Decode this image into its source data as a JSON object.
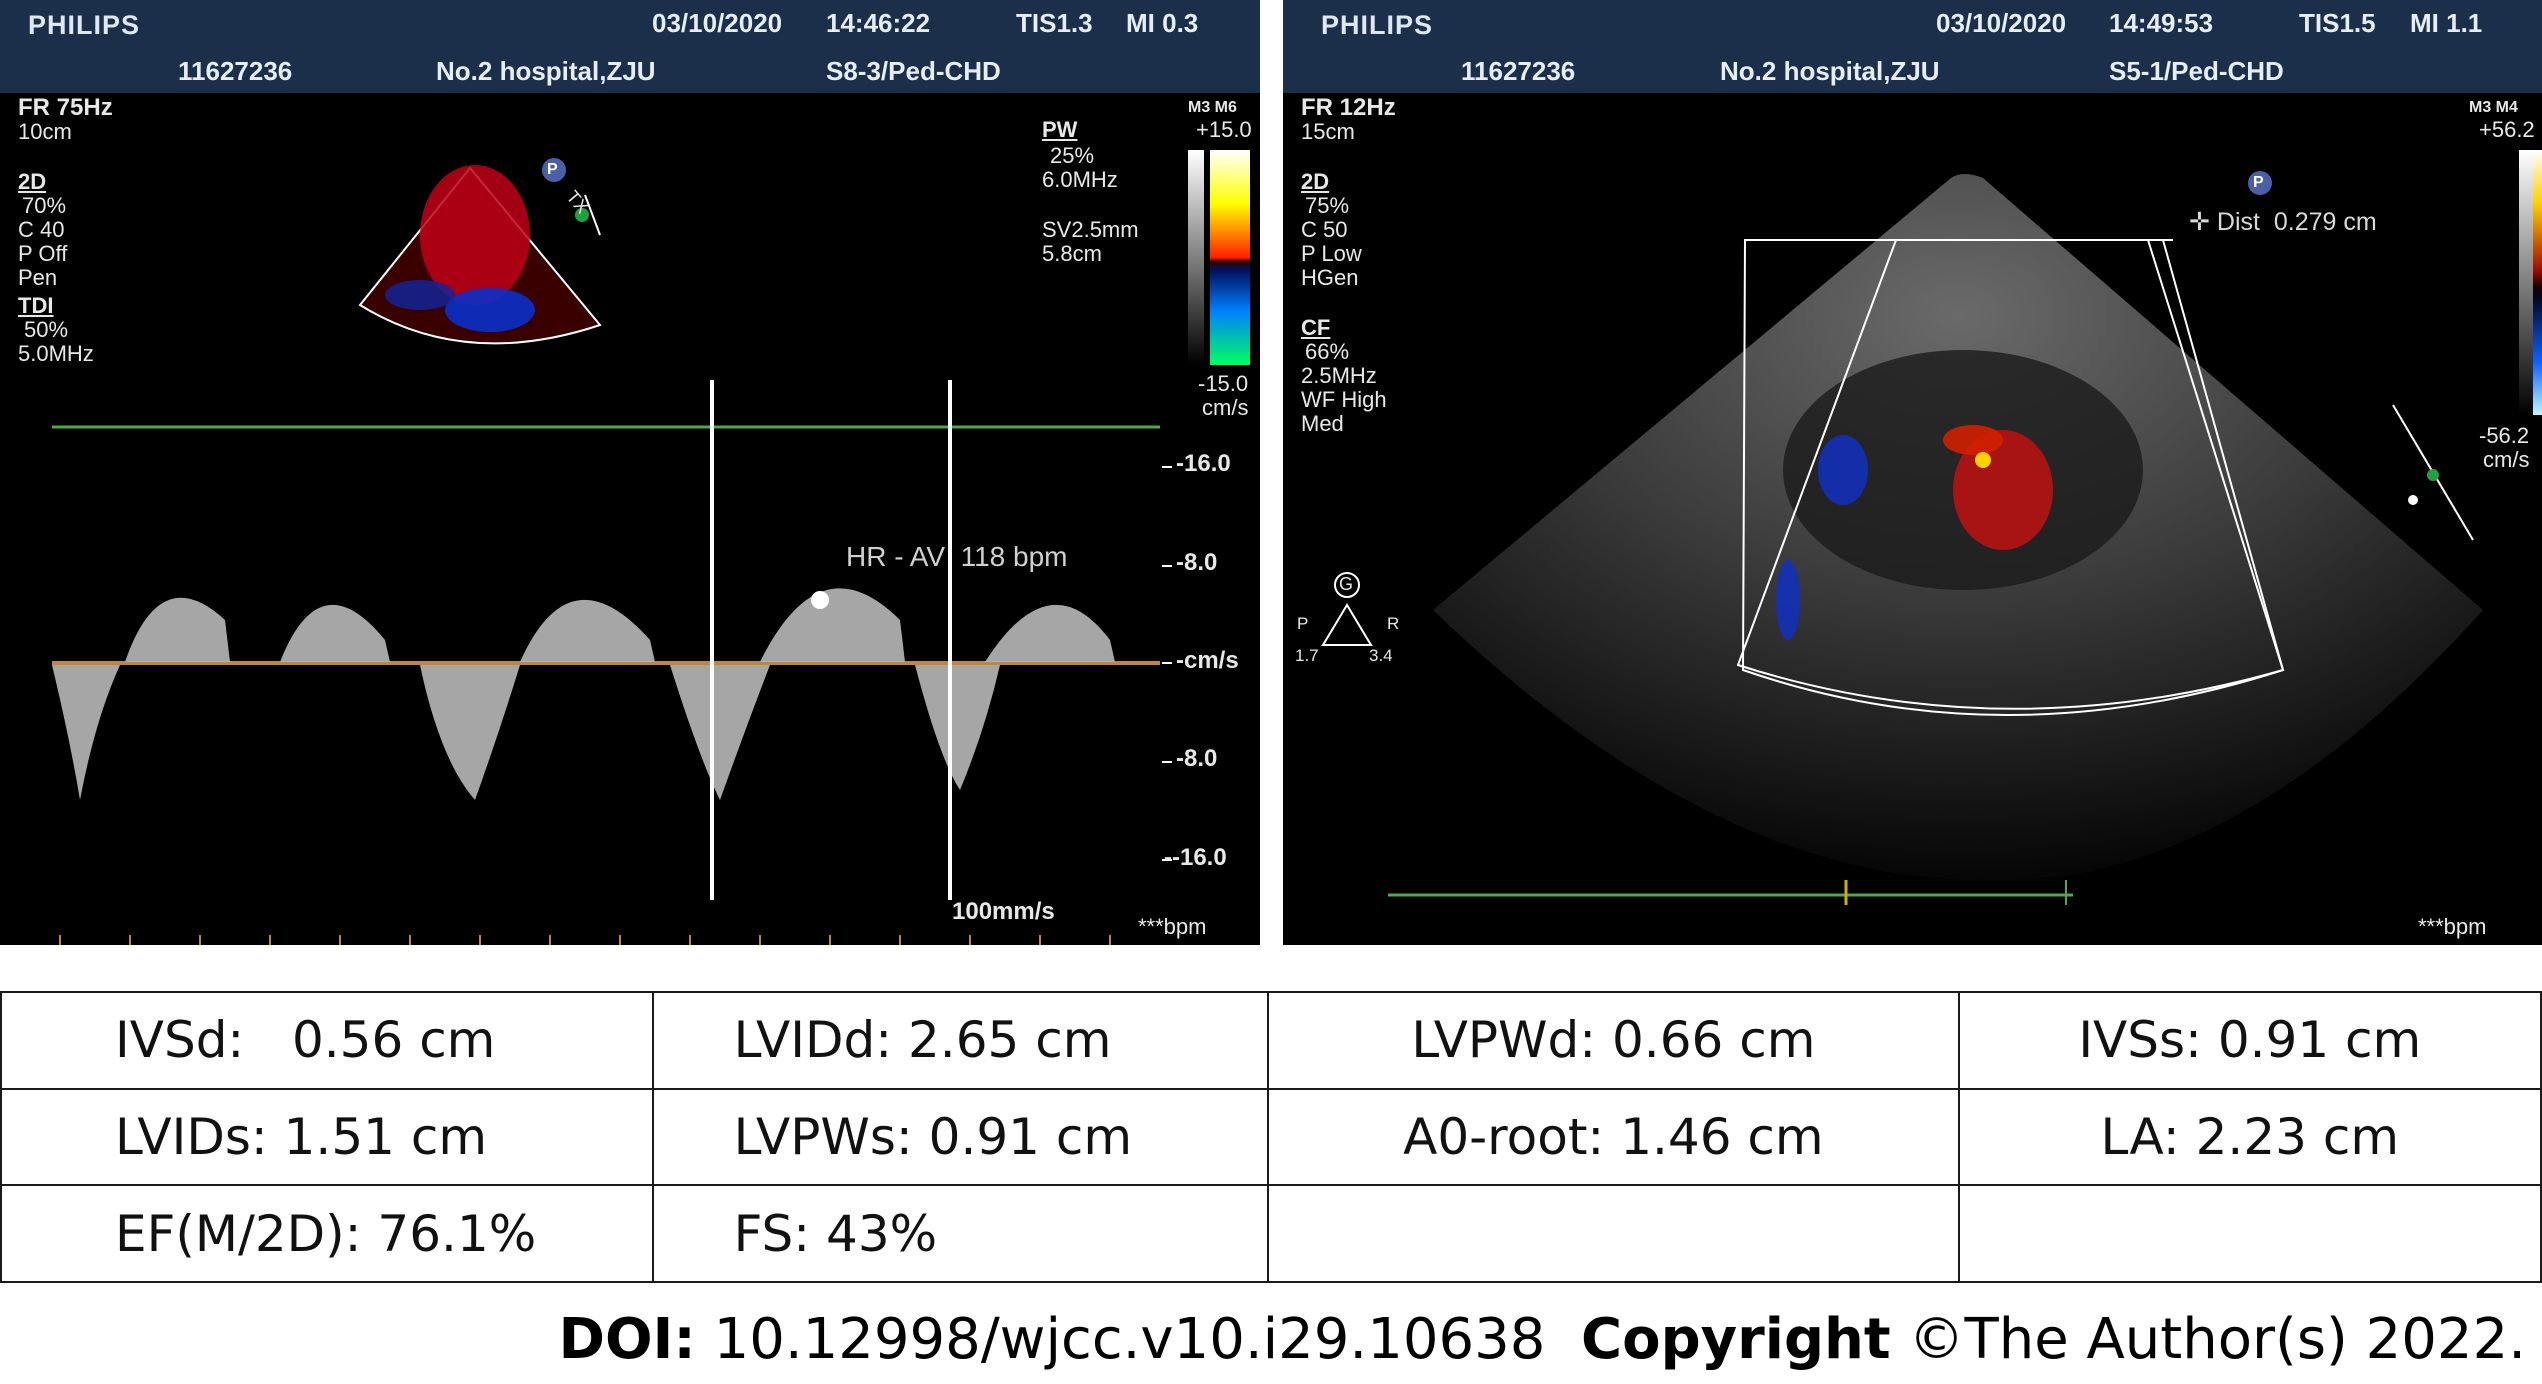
{
  "left_panel": {
    "brand": "PHILIPS",
    "date": "03/10/2020",
    "time": "14:46:22",
    "tis": "TIS1.3",
    "mi": "MI 0.3",
    "patient_id": "11627236",
    "hospital": "No.2 hospital,ZJU",
    "probe": "S8-3/Ped-CHD",
    "fr": "FR 75Hz",
    "depth": "10cm",
    "params_2d_title": "2D",
    "params_2d": [
      "70%",
      "C 40",
      "P Off",
      "Pen"
    ],
    "tdi_title": "TDI",
    "tdi_params": [
      "50%",
      "5.0MHz"
    ],
    "pw_title": "PW",
    "pw_params": [
      "25%",
      "6.0MHz"
    ],
    "sv": [
      "SV2.5mm",
      "5.8cm"
    ],
    "colorbar_top_label": "M3 M6",
    "colorbar_max": "+15.0",
    "colorbar_min": "-15.0",
    "colorbar_unit": "cm/s",
    "scale_ticks": [
      "-16.0",
      "-8.0",
      "-cm/s",
      "-8.0",
      "--16.0"
    ],
    "hr_text": "HR - AV  118 bpm",
    "sweep": "100mm/s",
    "bpm": "***bpm",
    "probe_marker": "P",
    "tx_marker": "TX"
  },
  "right_panel": {
    "brand": "PHILIPS",
    "date": "03/10/2020",
    "time": "14:49:53",
    "tis": "TIS1.5",
    "mi": "MI 1.1",
    "patient_id": "11627236",
    "hospital": "No.2 hospital,ZJU",
    "probe": "S5-1/Ped-CHD",
    "fr": "FR 12Hz",
    "depth": "15cm",
    "params_2d_title": "2D",
    "params_2d": [
      "75%",
      "C 50",
      "P Low",
      "HGen"
    ],
    "cf_title": "CF",
    "cf_params": [
      "66%",
      "2.5MHz",
      "WF High",
      "Med"
    ],
    "colorbar_top_label": "M3 M4",
    "colorbar_max": "+56.2",
    "colorbar_min": "-56.2",
    "colorbar_unit": "cm/s",
    "dist_text": "Dist  0.279 cm",
    "gain_label": "G",
    "gain_p": "P",
    "gain_r": "R",
    "gain_left": "1.7",
    "gain_right": "3.4",
    "bpm": "***bpm",
    "probe_marker": "P"
  },
  "measurements": [
    [
      {
        "label": "IVSd:",
        "value": "0.56 cm"
      },
      {
        "label": "LVIDd:",
        "value": "2.65 cm"
      },
      {
        "label": "LVPWd:",
        "value": "0.66 cm"
      },
      {
        "label": "IVSs:",
        "value": "0.91 cm"
      }
    ],
    [
      {
        "label": "LVIDs:",
        "value": "1.51 cm"
      },
      {
        "label": "LVPWs:",
        "value": "0.91 cm"
      },
      {
        "label": "A0-root:",
        "value": "1.46 cm"
      },
      {
        "label": "LA:",
        "value": "2.23 cm"
      }
    ],
    [
      {
        "label": "EF(M/2D):",
        "value": "76.1%"
      },
      {
        "label": "FS:",
        "value": "43%"
      },
      {
        "label": "",
        "value": ""
      },
      {
        "label": "",
        "value": ""
      }
    ]
  ],
  "footer": {
    "doi_label": "DOI:",
    "doi_value": "10.12998/wjcc.v10.i29.10638",
    "copyright_label": "Copyright",
    "copyright_value": "©The Author(s) 2022."
  }
}
